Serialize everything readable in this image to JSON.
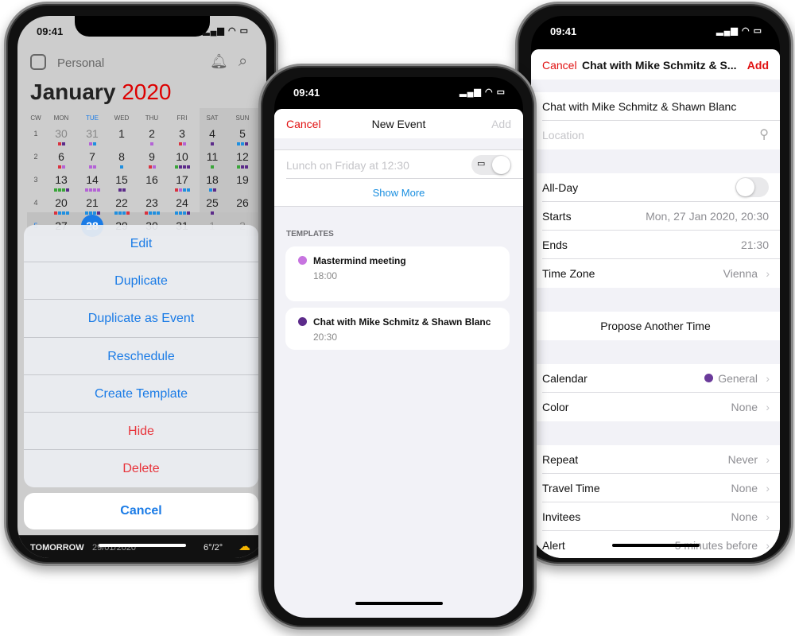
{
  "status": {
    "time": "09:41",
    "signal": "signal-icon",
    "wifi": "wifi-icon",
    "battery": "battery-icon"
  },
  "colors": {
    "accent_blue": "#1a7be6",
    "red": "#e01010",
    "dot_r": "#d9333f",
    "dot_lp": "#b463d6",
    "dot_dp": "#5c2b8a",
    "dot_b": "#1f8fe0",
    "dot_g": "#3aa53a"
  },
  "left": {
    "calendar_name": "Personal",
    "month": "January",
    "year": "2020",
    "weekdays": [
      "CW",
      "MON",
      "TUE",
      "WED",
      "THU",
      "FRI",
      "SAT",
      "SUN"
    ],
    "weeks": [
      {
        "cw": "1",
        "days": [
          "30",
          "31",
          "1",
          "2",
          "3",
          "4",
          "5"
        ],
        "dots": [
          [
            "r",
            "dp"
          ],
          [
            "lp",
            "b"
          ],
          [],
          [
            "lp"
          ],
          [
            "r",
            "lp"
          ],
          [
            "dp"
          ],
          [
            "b",
            "b",
            "dp"
          ]
        ]
      },
      {
        "cw": "2",
        "days": [
          "6",
          "7",
          "8",
          "9",
          "10",
          "11",
          "12"
        ],
        "dots": [
          [
            "r",
            "lp"
          ],
          [
            "lp",
            "lp"
          ],
          [
            "b"
          ],
          [
            "r",
            "lp"
          ],
          [
            "g",
            "dp",
            "dp",
            "dp"
          ],
          [
            "g"
          ],
          [
            "g",
            "dp",
            "dp"
          ]
        ]
      },
      {
        "cw": "3",
        "days": [
          "13",
          "14",
          "15",
          "16",
          "17",
          "18",
          "19"
        ],
        "dots": [
          [
            "g",
            "g",
            "g",
            "dp"
          ],
          [
            "lp",
            "lp",
            "lp",
            "lp"
          ],
          [
            "dp",
            "dp"
          ],
          [],
          [
            "r",
            "lp",
            "b",
            "b"
          ],
          [
            "b",
            "dp"
          ],
          []
        ]
      },
      {
        "cw": "4",
        "days": [
          "20",
          "21",
          "22",
          "23",
          "24",
          "25",
          "26"
        ],
        "dots": [
          [
            "r",
            "b",
            "b",
            "b"
          ],
          [
            "b",
            "b",
            "b",
            "dp"
          ],
          [
            "b",
            "b",
            "b",
            "r"
          ],
          [
            "r",
            "b",
            "b",
            "b"
          ],
          [
            "b",
            "b",
            "b",
            "dp"
          ],
          [
            "dp"
          ],
          []
        ]
      },
      {
        "cw": "5",
        "days": [
          "27",
          "28",
          "29",
          "30",
          "31",
          "1",
          "2"
        ],
        "dots": [
          [],
          [],
          [],
          [],
          [],
          [],
          []
        ]
      }
    ],
    "today": "28",
    "action_sheet": [
      "Edit",
      "Duplicate",
      "Duplicate as Event",
      "Reschedule",
      "Create Template",
      "Hide",
      "Delete"
    ],
    "cancel": "Cancel",
    "bottom": {
      "day": "TOMORROW",
      "date": "29/01/2020",
      "temp": "6°/2°"
    }
  },
  "middle": {
    "cancel": "Cancel",
    "title": "New Event",
    "add": "Add",
    "input_placeholder": "Lunch on Friday at 12:30",
    "show_more": "Show More",
    "templates_header": "TEMPLATES",
    "templates": [
      {
        "title": "Mastermind meeting",
        "time": "18:00",
        "color": "#c774e0"
      },
      {
        "title": "Chat with Mike Schmitz & Shawn Blanc",
        "time": "20:30",
        "color": "#5c2b8a"
      }
    ]
  },
  "right": {
    "cancel": "Cancel",
    "title": "Chat with Mike Schmitz & S...",
    "add": "Add",
    "event_title": "Chat with Mike Schmitz & Shawn Blanc",
    "location_placeholder": "Location",
    "all_day": "All-Day",
    "all_day_on": false,
    "rows": [
      {
        "label": "Starts",
        "value": "Mon, 27 Jan 2020, 20:30",
        "chevron": false
      },
      {
        "label": "Ends",
        "value": "21:30",
        "chevron": false
      },
      {
        "label": "Time Zone",
        "value": "Vienna",
        "chevron": true
      }
    ],
    "propose": "Propose Another Time",
    "rows2": [
      {
        "label": "Calendar",
        "value": "General",
        "chevron": true,
        "dot": "#6a3a9a"
      },
      {
        "label": "Color",
        "value": "None",
        "chevron": true
      }
    ],
    "rows3": [
      {
        "label": "Repeat",
        "value": "Never",
        "chevron": true
      },
      {
        "label": "Travel Time",
        "value": "None",
        "chevron": true
      },
      {
        "label": "Invitees",
        "value": "None",
        "chevron": true
      },
      {
        "label": "Alert",
        "value": "5 minutes before",
        "chevron": true
      }
    ]
  }
}
